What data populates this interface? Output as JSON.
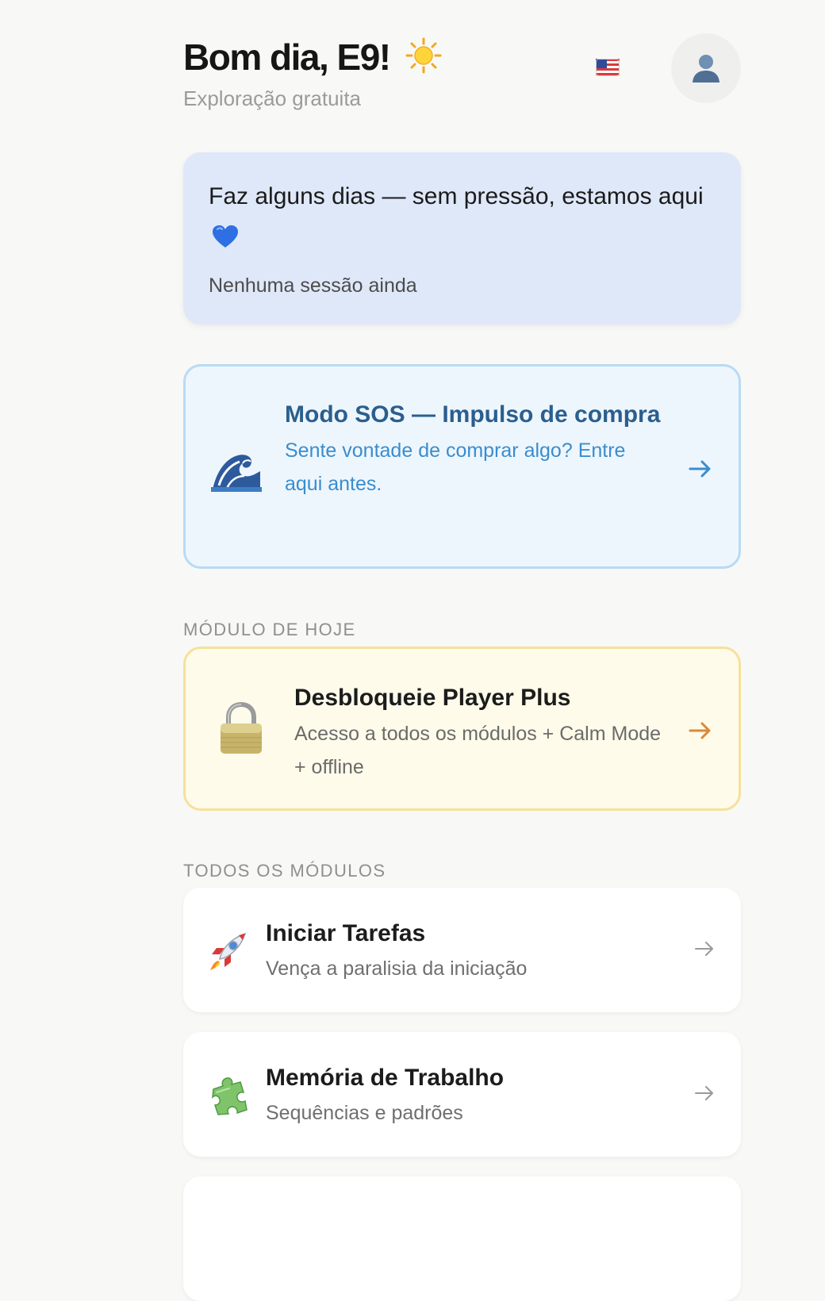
{
  "header": {
    "greeting": "Bom dia, E9!",
    "greeting_icon": "sun-icon",
    "plan_label": "Exploração gratuita",
    "language_flag_icon": "us-flag-icon",
    "profile_icon": "user-icon"
  },
  "status_card": {
    "title": "Faz alguns dias — sem pressão, estamos aqui",
    "title_icon": "blue-heart-icon",
    "subtitle": "Nenhuma sessão ainda"
  },
  "sos_card": {
    "icon": "wave-icon",
    "title": "Modo SOS — Impulso de compra",
    "subtitle": "Sente vontade de comprar algo? Entre aqui antes.",
    "accent_color": "#3a8dce"
  },
  "today_section": {
    "label": "MÓDULO DE HOJE",
    "card": {
      "icon": "lock-icon",
      "title": "Desbloqueie Player Plus",
      "subtitle": "Acesso a todos os módulos + Calm Mode + offline",
      "accent_color": "#d98a3a"
    }
  },
  "modules_section": {
    "label": "TODOS OS MÓDULOS",
    "items": [
      {
        "icon": "rocket-icon",
        "title": "Iniciar Tarefas",
        "subtitle": "Vença a paralisia da iniciação"
      },
      {
        "icon": "puzzle-piece-icon",
        "title": "Memória de Trabalho",
        "subtitle": "Sequências e padrões"
      }
    ]
  }
}
